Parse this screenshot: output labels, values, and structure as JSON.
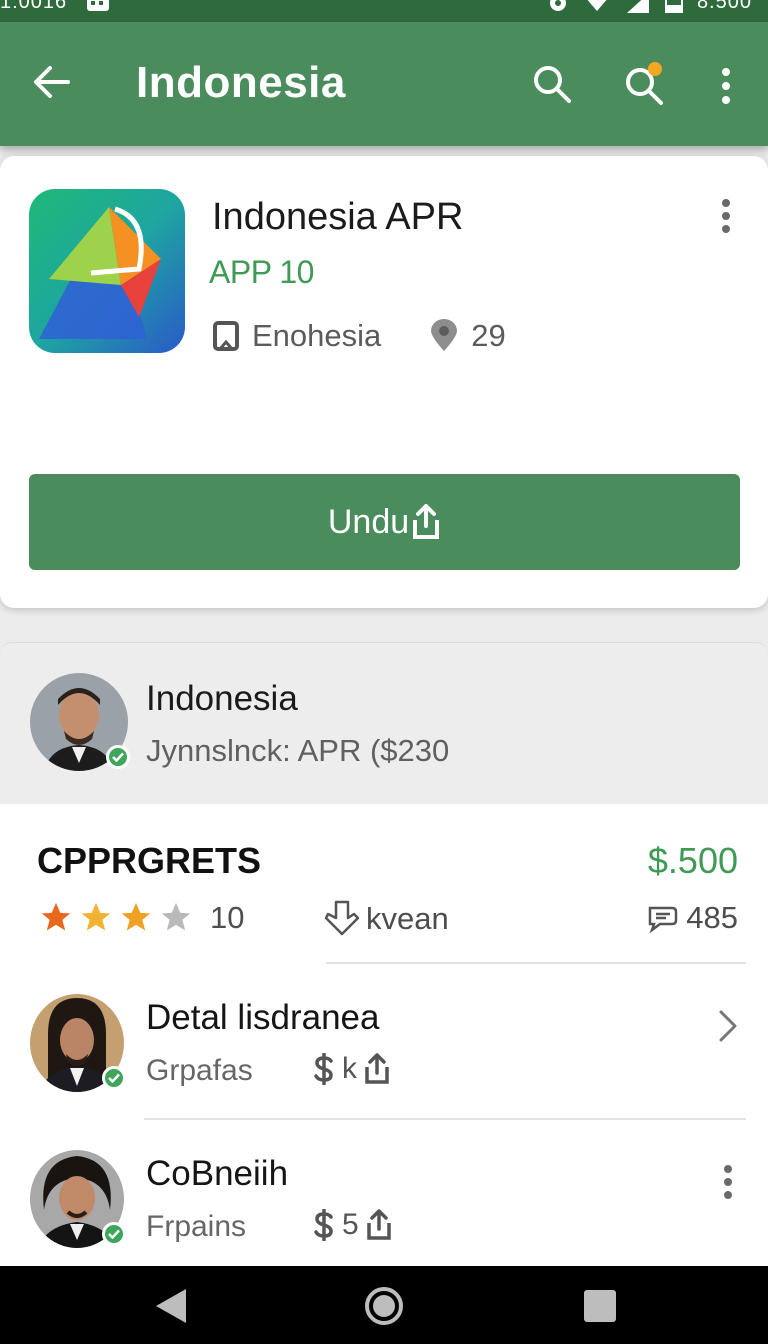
{
  "status_bar": {
    "time": "1:0016",
    "battery_text": "8.500"
  },
  "app_bar": {
    "title": "Indonesia",
    "icons": {
      "back": "arrow-back-icon",
      "search": "search-icon",
      "search_alert": "search-notification-icon",
      "menu": "more-vert-icon"
    },
    "alert_dot_color": "#f5a623"
  },
  "app": {
    "name": "Indonesia APR",
    "version": "APP 10",
    "category": "Enohesia",
    "location_count": "29",
    "download_label": "Undu"
  },
  "publisher": {
    "name": "Indonesia",
    "subtitle": "Jynnslnck: APR ($230"
  },
  "list": {
    "title": "CPPRGRETS",
    "price": "$.500",
    "rating_count": "10",
    "stars_filled": 3,
    "stars_total": 4,
    "download_text": "kvean",
    "review_count": "485",
    "rows": [
      {
        "title": "Detal lisdranea",
        "subtitle": "Grpafas",
        "stat": "k",
        "action": "chevron-right-icon"
      },
      {
        "title": "CoBneiih",
        "subtitle": "Frpains",
        "stat": "5",
        "action": "more-vert-icon"
      }
    ]
  },
  "colors": {
    "primary": "#4a8c5c",
    "status_bar": "#2f6a3d",
    "accent_green": "#3f9a55",
    "star": "#f0a023"
  }
}
